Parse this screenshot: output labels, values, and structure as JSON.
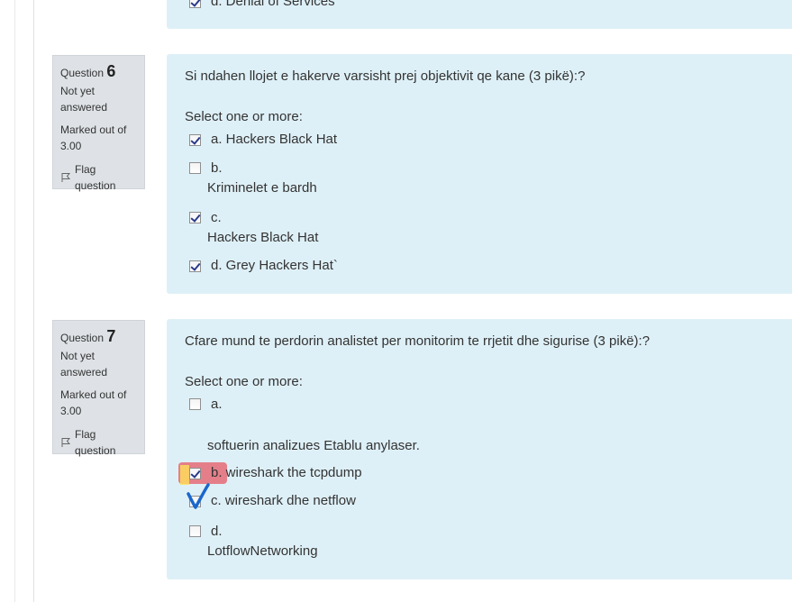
{
  "colors": {
    "question_box_bg": "#def0f7",
    "info_box_bg": "#dee2e6",
    "annotation_red": "#e65a64",
    "annotation_blue": "#1a66cc"
  },
  "top_partial": {
    "option_label": "d. Denial of Services",
    "checked": true
  },
  "questions": [
    {
      "label": "Question",
      "number": "6",
      "state": "Not yet answered",
      "grade": "Marked out of 3.00",
      "flag_label": "Flag question",
      "text": "Si ndahen llojet e hakerve  varsisht prej objektivit qe kane (3 pikë):?",
      "prompt": "Select one or more:",
      "options": [
        {
          "label": "a. Hackers Black Hat",
          "extra": "",
          "checked": true
        },
        {
          "label": "b.",
          "extra": "Kriminelet e bardh",
          "checked": false
        },
        {
          "label": "c.",
          "extra": "Hackers Black Hat",
          "checked": true
        },
        {
          "label": "d. Grey Hackers Hat`",
          "extra": "",
          "checked": true
        }
      ]
    },
    {
      "label": "Question",
      "number": "7",
      "state": "Not yet answered",
      "grade": "Marked out of 3.00",
      "flag_label": "Flag question",
      "text": "Cfare mund te perdorin analistet per monitorim te rrjetit dhe sigurise (3 pikë):?",
      "prompt": "Select one or more:",
      "options": [
        {
          "label": "a.",
          "extra": "softuerin analizues Etablu anylaser.",
          "checked": false
        },
        {
          "label": "b. wireshark the tcpdump",
          "extra": "",
          "checked": true
        },
        {
          "label": "c. wireshark dhe netflow",
          "extra": "",
          "checked": false
        },
        {
          "label": "d.",
          "extra": "LotflowNetworking",
          "checked": false
        }
      ]
    }
  ]
}
